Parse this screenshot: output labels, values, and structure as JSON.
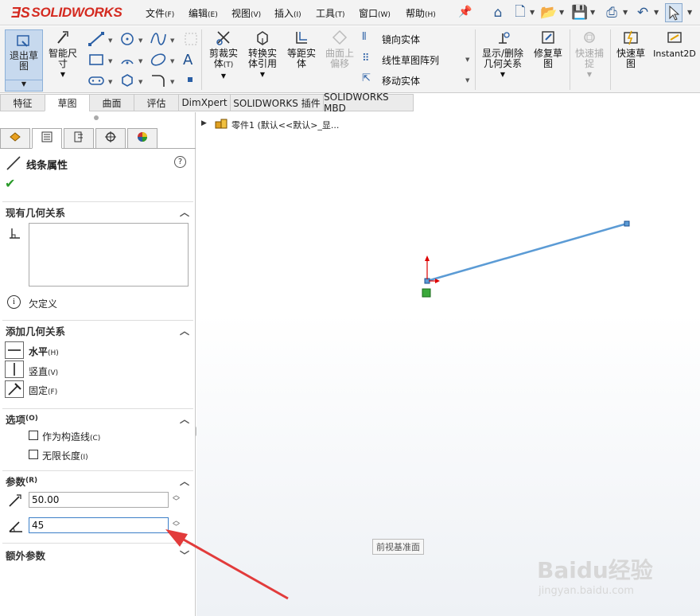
{
  "app": {
    "logo": "SOLIDWORKS",
    "menu": [
      {
        "label": "文件",
        "key": "(F)"
      },
      {
        "label": "编辑",
        "key": "(E)"
      },
      {
        "label": "视图",
        "key": "(V)"
      },
      {
        "label": "插入",
        "key": "(I)"
      },
      {
        "label": "工具",
        "key": "(T)"
      },
      {
        "label": "窗口",
        "key": "(W)"
      },
      {
        "label": "帮助",
        "key": "(H)"
      }
    ]
  },
  "ribbon": {
    "exit_sketch": [
      "退出草",
      "图"
    ],
    "smart_dim": [
      "智能尺",
      "寸"
    ],
    "trim": [
      "剪裁实",
      "体",
      "(T)"
    ],
    "convert": [
      "转换实",
      "体引用"
    ],
    "offset": [
      "等距实",
      "体"
    ],
    "surface_offset": [
      "曲面上",
      "偏移"
    ],
    "mirror": "镜向实体",
    "linear_pattern": "线性草图阵列",
    "move": "移动实体",
    "show_relations": [
      "显示/删除",
      "几何关系"
    ],
    "repair": [
      "修复草",
      "图"
    ],
    "quick_snap": [
      "快速捕",
      "捉"
    ],
    "rapid_sketch": [
      "快速草",
      "图"
    ],
    "instant2d": "Instant2D"
  },
  "tabs": [
    "特征",
    "草图",
    "曲面",
    "评估",
    "DimXpert",
    "SOLIDWORKS 插件",
    "SOLIDWORKS MBD"
  ],
  "panel": {
    "title": "线条属性",
    "existing_relations": {
      "header": "现有几何关系",
      "status": "欠定义"
    },
    "add_relations": {
      "header": "添加几何关系",
      "items": [
        {
          "label": "水平",
          "key": "(H)",
          "icon": "horizontal-icon"
        },
        {
          "label": "竖直",
          "key": "(V)",
          "icon": "vertical-icon"
        },
        {
          "label": "固定",
          "key": "(F)",
          "icon": "fix-icon"
        }
      ]
    },
    "options": {
      "header": "选项",
      "header_key": "(O)",
      "items": [
        {
          "label": "作为构造线",
          "key": "(C)",
          "checked": false
        },
        {
          "label": "无限长度",
          "key": "(I)",
          "checked": false
        }
      ]
    },
    "parameters": {
      "header": "参数",
      "header_key": "(R)",
      "length": "50.00",
      "angle": "45"
    },
    "extra": {
      "header": "额外参数"
    }
  },
  "tree": {
    "root_label": "零件1 (默认<<默认>_显..."
  },
  "canvas": {
    "plane_label": "前视基准面"
  },
  "watermark": {
    "brand": "Baidu经验",
    "url": "jingyan.baidu.com"
  },
  "colors": {
    "accent": "#2a5fa5",
    "sketch_line": "#5b9bd5",
    "logo_red": "#d42a20",
    "confirm_green": "#2a9a2a"
  }
}
